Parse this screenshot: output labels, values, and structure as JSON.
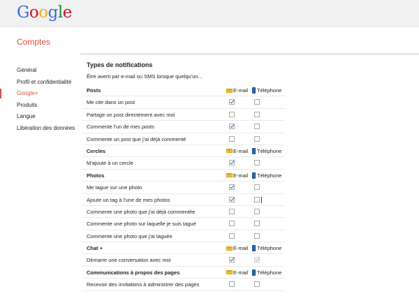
{
  "logo": {
    "letters": [
      "G",
      "o",
      "o",
      "g",
      "l",
      "e"
    ],
    "colors": [
      "#3369e8",
      "#d50f25",
      "#eeb211",
      "#3369e8",
      "#009925",
      "#d50f25"
    ]
  },
  "header": {
    "title": "Comptes"
  },
  "sidebar": {
    "items": [
      {
        "label": "Général",
        "active": false
      },
      {
        "label": "Profil et confidentialité",
        "active": false
      },
      {
        "label": "Google+",
        "active": true
      },
      {
        "label": "Produits",
        "active": false
      },
      {
        "label": "Langue",
        "active": false
      },
      {
        "label": "Libération des données",
        "active": false
      }
    ]
  },
  "main": {
    "title": "Types de notifications",
    "description": "Être averti par e-mail ou SMS lorsque quelqu'un..."
  },
  "columns": {
    "email": "E-mail",
    "phone": "Téléphone"
  },
  "sections": [
    {
      "title": "Posts",
      "rows": [
        {
          "label": "Me cite dans un post",
          "email": true,
          "phone": false
        },
        {
          "label": "Partage un post directement avec moi",
          "email": false,
          "phone": false
        },
        {
          "label": "Commente l'un de mes posts",
          "email": true,
          "phone": false
        },
        {
          "label": "Commente un post que j'ai déjà commenté",
          "email": false,
          "phone": false
        }
      ]
    },
    {
      "title": "Cercles",
      "rows": [
        {
          "label": "M'ajoute à un cercle",
          "email": true,
          "phone": false
        }
      ]
    },
    {
      "title": "Photos",
      "rows": [
        {
          "label": "Me tague sur une photo",
          "email": true,
          "phone": false
        },
        {
          "label": "Ajoute un tag à l'une de mes photos",
          "email": true,
          "phone": false,
          "focused": true
        },
        {
          "label": "Commente une photo que j'ai déjà commentée",
          "email": false,
          "phone": false
        },
        {
          "label": "Commente une photo sur laquelle je suis tagué",
          "email": false,
          "phone": false
        },
        {
          "label": "Commente une photo que j'ai taguée",
          "email": false,
          "phone": false
        }
      ]
    },
    {
      "title": "Chat +",
      "rows": [
        {
          "label": "Démarre une conversation avec moi",
          "email": true,
          "phone": true,
          "phone_disabled": true
        }
      ]
    },
    {
      "title": "Communications à propos des pages",
      "rows": [
        {
          "label": "Recevoir des invitations à administrer des pages",
          "email": false,
          "phone": false
        }
      ]
    }
  ],
  "colors": {
    "accent": "#dd4b39",
    "checkmark": "#3b5aa8",
    "mail_icon": "#f6c431",
    "phone_icon": "#2a67b3"
  }
}
